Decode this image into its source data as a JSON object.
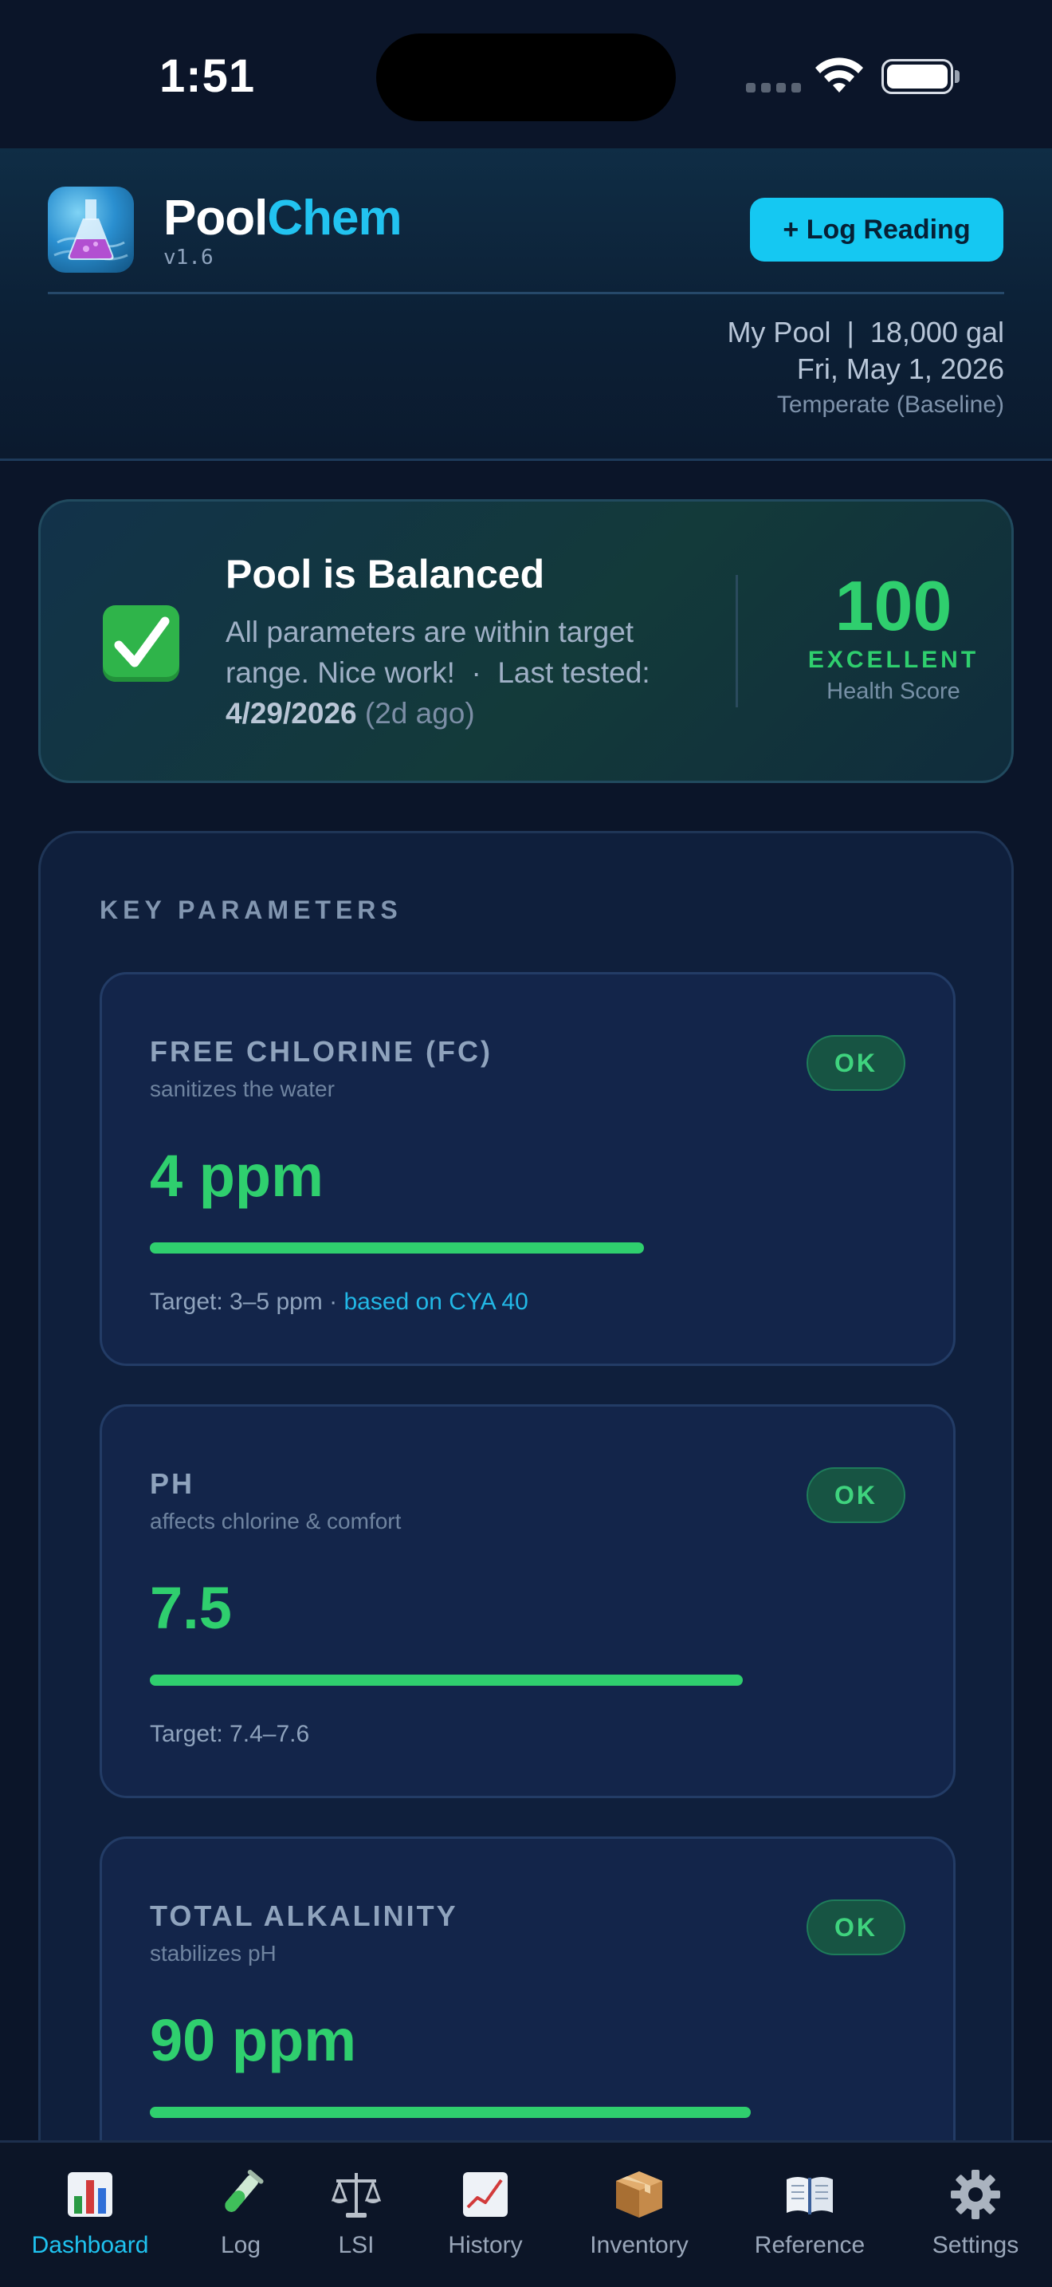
{
  "status_bar": {
    "time": "1:51"
  },
  "header": {
    "app_name_part1": "Pool",
    "app_name_part2": "Chem",
    "version": "v1.6",
    "log_button_label": "+ Log Reading",
    "pool_summary": "My Pool  |  18,000 gal",
    "date": "Fri, May 1, 2026",
    "climate": "Temperate (Baseline)"
  },
  "balance": {
    "title": "Pool is Balanced",
    "message": "All parameters are within target range. Nice work!  ·  Last tested:",
    "last_tested_date": "4/29/2026",
    "last_tested_ago": "(2d ago)",
    "score": "100",
    "grade": "EXCELLENT",
    "score_label": "Health Score",
    "status_color": "#2fcf6e"
  },
  "key_parameters": {
    "heading": "KEY PARAMETERS",
    "items": [
      {
        "name": "FREE CHLORINE (FC)",
        "description": "sanitizes the water",
        "status": "OK",
        "value": "4 ppm",
        "level": 0.65,
        "target": "Target: 3–5 ppm · ",
        "target_note": "based on CYA 40"
      },
      {
        "name": "PH",
        "description": "affects chlorine & comfort",
        "status": "OK",
        "value": "7.5",
        "level": 0.78,
        "target": "Target: 7.4–7.6",
        "target_note": ""
      },
      {
        "name": "TOTAL ALKALINITY",
        "description": "stabilizes pH",
        "status": "OK",
        "value": "90 ppm",
        "level": 0.79,
        "target": "",
        "target_note": ""
      }
    ]
  },
  "tabs": [
    {
      "label": "Dashboard",
      "icon": "bar-chart-icon",
      "active": true
    },
    {
      "label": "Log",
      "icon": "test-tube-icon",
      "active": false
    },
    {
      "label": "LSI",
      "icon": "balance-scale-icon",
      "active": false
    },
    {
      "label": "History",
      "icon": "line-chart-icon",
      "active": false
    },
    {
      "label": "Inventory",
      "icon": "package-icon",
      "active": false
    },
    {
      "label": "Reference",
      "icon": "book-icon",
      "active": false
    },
    {
      "label": "Settings",
      "icon": "gear-icon",
      "active": false
    }
  ],
  "colors": {
    "accent": "#15c8f2",
    "ok": "#2fcf6e",
    "background": "#0b1529"
  }
}
